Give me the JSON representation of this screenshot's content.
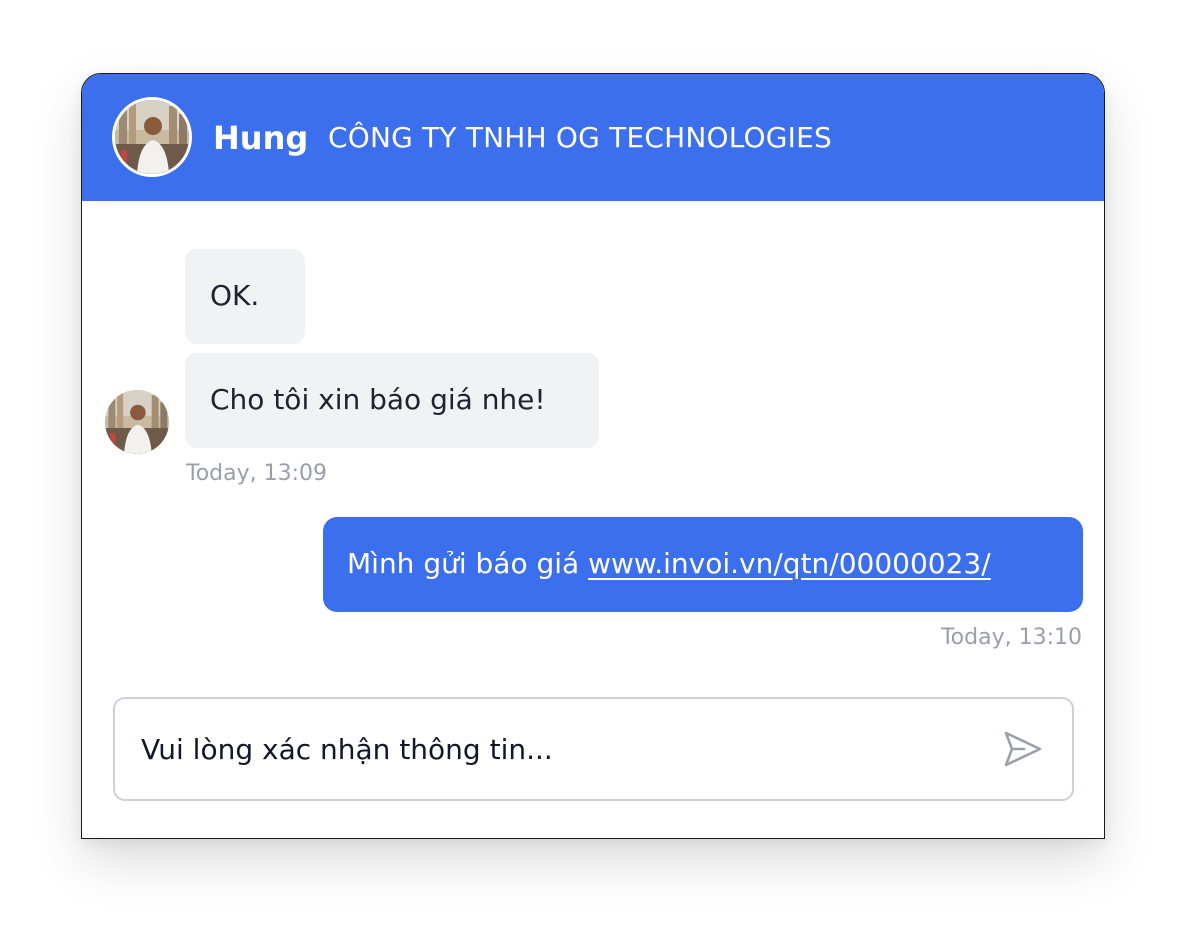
{
  "header": {
    "name": "Hung",
    "company": "CÔNG TY TNHH OG TECHNOLOGIES"
  },
  "messages": [
    {
      "direction": "incoming",
      "text": "OK."
    },
    {
      "direction": "incoming",
      "text": "Cho tôi xin báo giá nhe!"
    },
    {
      "direction": "outgoing",
      "text": "Mình gửi báo giá ",
      "link": "www.invoi.vn/qtn/00000023/"
    }
  ],
  "timestamps": {
    "incoming": "Today, 13:09",
    "outgoing": "Today, 13:10"
  },
  "composer": {
    "placeholder": "Vui lòng xác nhận thông tin...",
    "send_icon": "send-icon"
  },
  "colors": {
    "accent": "#3b6fee",
    "incoming_bubble": "#f1f2f4",
    "timestamp": "#9aa0aa"
  }
}
